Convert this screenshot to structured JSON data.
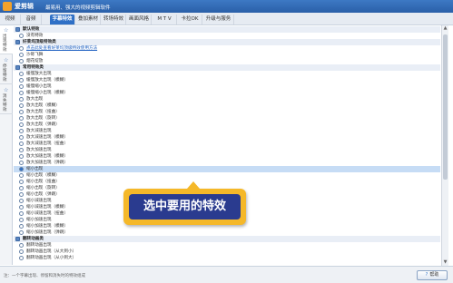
{
  "window": {
    "app_name": "爱剪辑",
    "slogan": "最易用、强大的视频剪辑软件"
  },
  "menu": {
    "tabs": [
      "视频",
      "音频",
      "字幕特效",
      "叠加素材",
      "转场特效",
      "画面风格",
      "M T V",
      "卡拉OK",
      "升级与服务"
    ],
    "active": 2
  },
  "sidebar": {
    "items": [
      {
        "icon": "☆",
        "label": "出现特效"
      },
      {
        "icon": "☆",
        "label": "停留特效"
      },
      {
        "icon": "☆",
        "label": "消失特效"
      }
    ]
  },
  "effects": {
    "rows": [
      {
        "text": "默认特效",
        "kind": "cat",
        "indent": 0
      },
      {
        "text": "没有特效",
        "kind": "item",
        "indent": 1
      },
      {
        "text": "好莱坞顶级特效类",
        "kind": "cat",
        "indent": 0
      },
      {
        "text": "点击此处查看好莱坞顶级特效使用方法",
        "kind": "link",
        "indent": 1
      },
      {
        "text": "沙砾飞舞",
        "kind": "item",
        "indent": 1
      },
      {
        "text": "烟花绽放",
        "kind": "item",
        "indent": 1
      },
      {
        "text": "常用特效类",
        "kind": "cat",
        "indent": 0
      },
      {
        "text": "缓慢放大出现",
        "kind": "item",
        "indent": 1
      },
      {
        "text": "缓慢放大出现（模糊）",
        "kind": "item",
        "indent": 1
      },
      {
        "text": "缓慢缩小出现",
        "kind": "item",
        "indent": 1
      },
      {
        "text": "缓慢缩小出现（模糊）",
        "kind": "item",
        "indent": 1
      },
      {
        "text": "放大出现",
        "kind": "item",
        "indent": 1
      },
      {
        "text": "放大出现（模糊）",
        "kind": "item",
        "indent": 1
      },
      {
        "text": "放大出现（扭曲）",
        "kind": "item",
        "indent": 1
      },
      {
        "text": "放大出现（旋转）",
        "kind": "item",
        "indent": 1
      },
      {
        "text": "放大出现（弹跳）",
        "kind": "item",
        "indent": 1
      },
      {
        "text": "放大减速出现",
        "kind": "item",
        "indent": 1
      },
      {
        "text": "放大减速出现（模糊）",
        "kind": "item",
        "indent": 1
      },
      {
        "text": "放大减速出现（扭曲）",
        "kind": "item",
        "indent": 1
      },
      {
        "text": "放大加速出现",
        "kind": "item",
        "indent": 1
      },
      {
        "text": "放大加速出现（模糊）",
        "kind": "item",
        "indent": 1
      },
      {
        "text": "放大加速出现（弹跳）",
        "kind": "item",
        "indent": 1
      },
      {
        "text": "缩小出现",
        "kind": "sel",
        "indent": 1
      },
      {
        "text": "缩小出现（模糊）",
        "kind": "item",
        "indent": 1
      },
      {
        "text": "缩小出现（扭曲）",
        "kind": "item",
        "indent": 1
      },
      {
        "text": "缩小出现（旋转）",
        "kind": "item",
        "indent": 1
      },
      {
        "text": "缩小出现（弹跳）",
        "kind": "item",
        "indent": 1
      },
      {
        "text": "缩小减速出现",
        "kind": "item",
        "indent": 1
      },
      {
        "text": "缩小减速出现（模糊）",
        "kind": "item",
        "indent": 1
      },
      {
        "text": "缩小减速出现（扭曲）",
        "kind": "item",
        "indent": 1
      },
      {
        "text": "缩小加速出现",
        "kind": "item",
        "indent": 1
      },
      {
        "text": "缩小加速出现（模糊）",
        "kind": "item",
        "indent": 1
      },
      {
        "text": "缩小加速出现（弹跳）",
        "kind": "item",
        "indent": 1
      },
      {
        "text": "翻转动画类",
        "kind": "cat",
        "indent": 0
      },
      {
        "text": "翻转动画出现",
        "kind": "item",
        "indent": 1
      },
      {
        "text": "翻转动画出现（从大到小）",
        "kind": "item",
        "indent": 1
      },
      {
        "text": "翻转动画出现（从小到大）",
        "kind": "item",
        "indent": 1
      }
    ]
  },
  "callout": {
    "text": "选中要用的特效"
  },
  "status": {
    "hint": "注：一个字幕出现、停留和消失时的特效组成",
    "button_label": "帮助",
    "button_icon": "?"
  },
  "colors": {
    "accent": "#2f70c6",
    "callout_bg": "#f5b829",
    "callout_inner": "#2a3b8f"
  }
}
